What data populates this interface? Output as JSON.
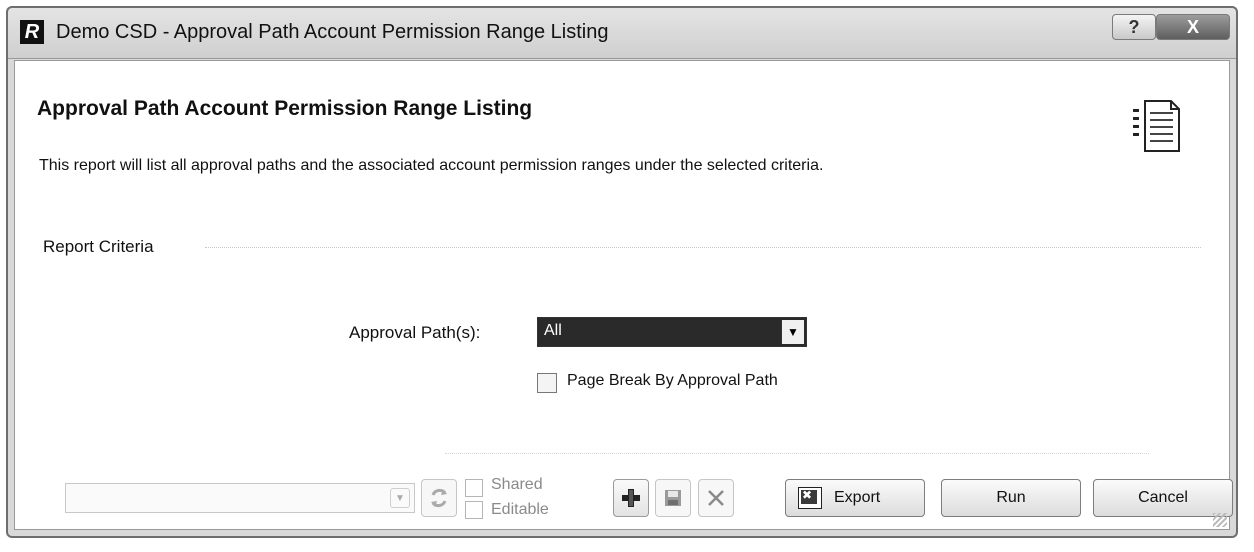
{
  "window": {
    "title": "Demo CSD - Approval Path Account Permission Range Listing",
    "logo_letter": "R",
    "help_label": "?",
    "close_label": "X"
  },
  "report": {
    "title": "Approval Path Account Permission Range Listing",
    "description": "This report will list all approval paths and the associated account permission ranges under the selected criteria.",
    "icon": "report-document-icon"
  },
  "criteria": {
    "section_label": "Report Criteria",
    "approval_path_label": "Approval Path(s):",
    "approval_path_value": "All",
    "page_break_label": "Page Break By Approval Path",
    "page_break_checked": false
  },
  "footer": {
    "layout_value": "",
    "shared_label": "Shared",
    "editable_label": "Editable",
    "export_label": "Export",
    "run_label": "Run",
    "cancel_label": "Cancel",
    "icons": {
      "refresh": "refresh-icon",
      "add": "plus-icon",
      "save": "save-icon",
      "delete": "delete-icon",
      "export": "excel-icon"
    }
  }
}
